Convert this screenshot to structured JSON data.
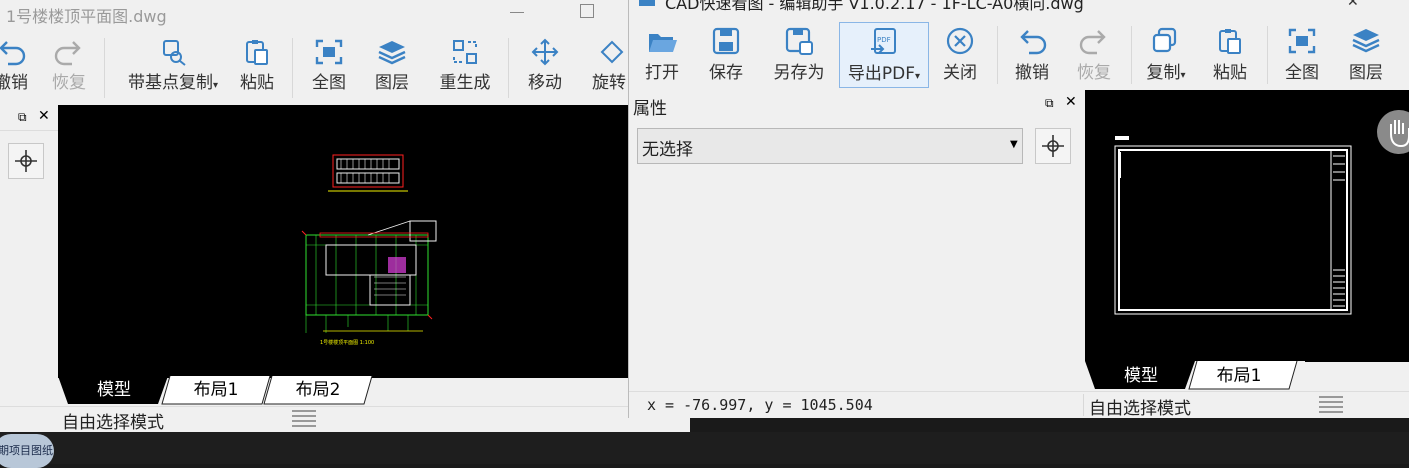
{
  "left_window": {
    "title": "1号楼楼顶平面图.dwg",
    "toolbar": [
      {
        "label": "撤销",
        "icon": "undo-icon"
      },
      {
        "label": "恢复",
        "icon": "redo-icon"
      },
      {
        "label": "带基点复制",
        "icon": "copy-base-icon"
      },
      {
        "label": "粘贴",
        "icon": "paste-icon"
      },
      {
        "label": "全图",
        "icon": "zoom-extents-icon"
      },
      {
        "label": "图层",
        "icon": "layers-icon"
      },
      {
        "label": "重生成",
        "icon": "regen-icon"
      },
      {
        "label": "移动",
        "icon": "move-icon"
      },
      {
        "label": "旋转",
        "icon": "rotate-icon"
      }
    ],
    "tabs": [
      "模型",
      "布局1",
      "布局2"
    ],
    "status": "自由选择模式",
    "drawing_caption": "1号楼楼顶平面图 1:100"
  },
  "right_window": {
    "title": "CAD快速看图 - 编辑助手 V1.0.2.17 - 1F-LC-A0横向.dwg",
    "toolbar": [
      {
        "label": "打开",
        "icon": "open-folder-icon"
      },
      {
        "label": "保存",
        "icon": "save-icon"
      },
      {
        "label": "另存为",
        "icon": "save-as-icon"
      },
      {
        "label": "导出PDF",
        "icon": "export-pdf-icon"
      },
      {
        "label": "关闭",
        "icon": "close-circle-icon"
      },
      {
        "label": "撤销",
        "icon": "undo-icon"
      },
      {
        "label": "恢复",
        "icon": "redo-icon"
      },
      {
        "label": "复制",
        "icon": "copy-icon"
      },
      {
        "label": "粘贴",
        "icon": "paste-icon"
      },
      {
        "label": "全图",
        "icon": "zoom-extents-icon"
      },
      {
        "label": "图层",
        "icon": "layers-icon"
      }
    ],
    "properties_panel": {
      "title": "属性",
      "selection": "无选择"
    },
    "coords": "x = -76.997,  y = 1045.504",
    "tabs": [
      "模型",
      "布局1"
    ],
    "status": "自由选择模式"
  },
  "taskbar": {
    "item_label": "期项目图纸"
  },
  "colors": {
    "accent": "#4a8fd6",
    "toolbar_bg": "#f0f0f0",
    "canvas": "#000000",
    "cad_yellow": "#f0f000",
    "cad_red": "#ff2020",
    "cad_green": "#30e030",
    "cad_magenta": "#e040e0"
  }
}
